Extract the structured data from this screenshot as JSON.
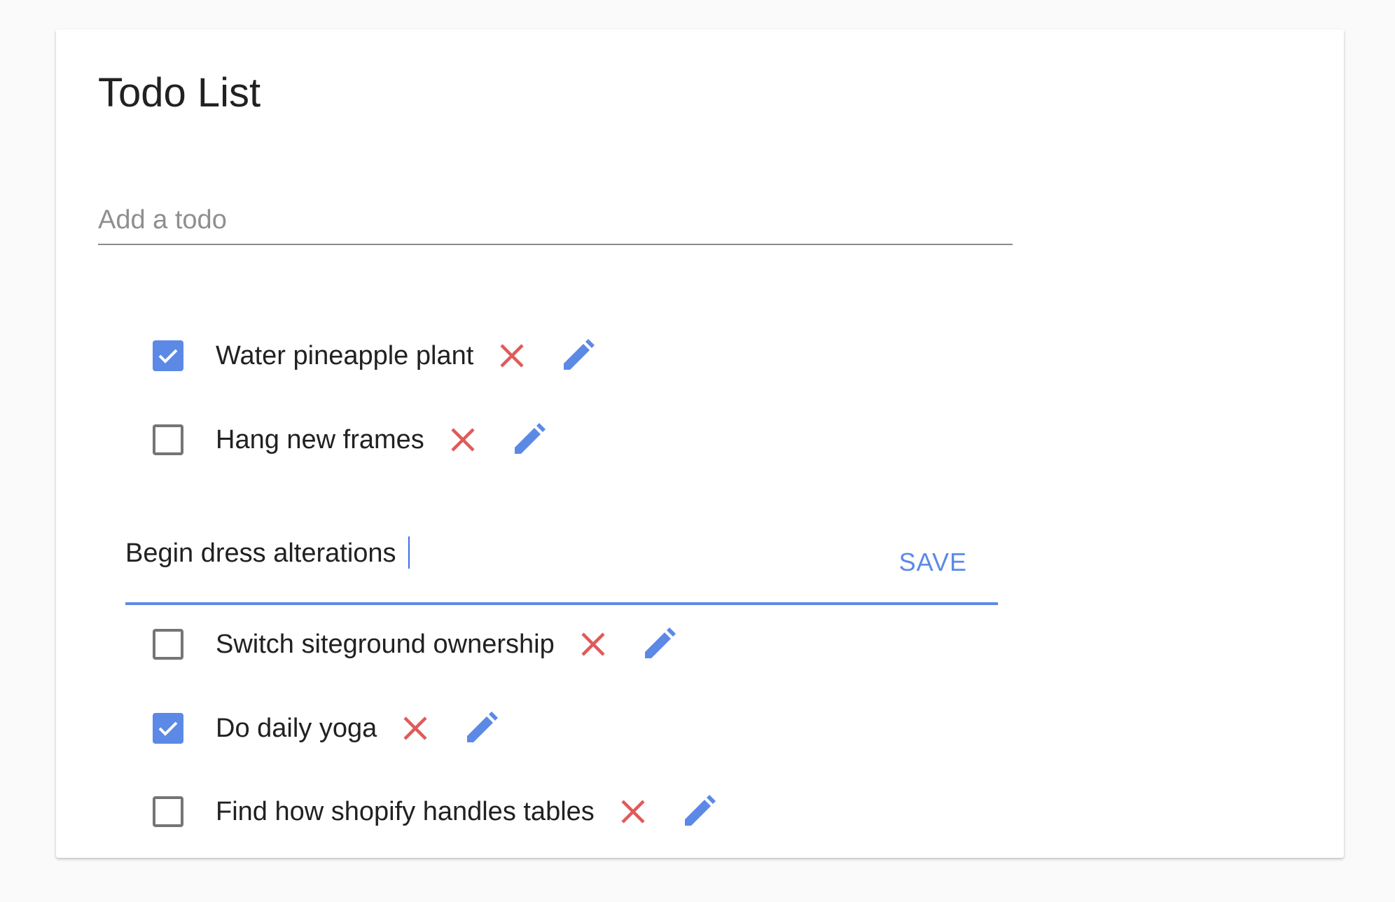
{
  "app": {
    "title": "Todo List"
  },
  "add_todo": {
    "placeholder": "Add a todo",
    "value": ""
  },
  "colors": {
    "accent": "#5c89e6",
    "delete": "#e05a5a",
    "checkbox_border": "#757575"
  },
  "todos": [
    {
      "text": "Water pineapple plant",
      "checked": true
    },
    {
      "text": "Hang new frames",
      "checked": false
    },
    {
      "text": "Switch siteground ownership",
      "checked": false
    },
    {
      "text": "Do daily yoga",
      "checked": true
    },
    {
      "text": "Find how shopify handles tables",
      "checked": false
    }
  ],
  "editing": {
    "value": "Begin dress alterations",
    "save_label": "SAVE"
  },
  "icons": {
    "check": "checkmark-icon",
    "delete": "close-icon",
    "edit": "pencil-icon"
  }
}
